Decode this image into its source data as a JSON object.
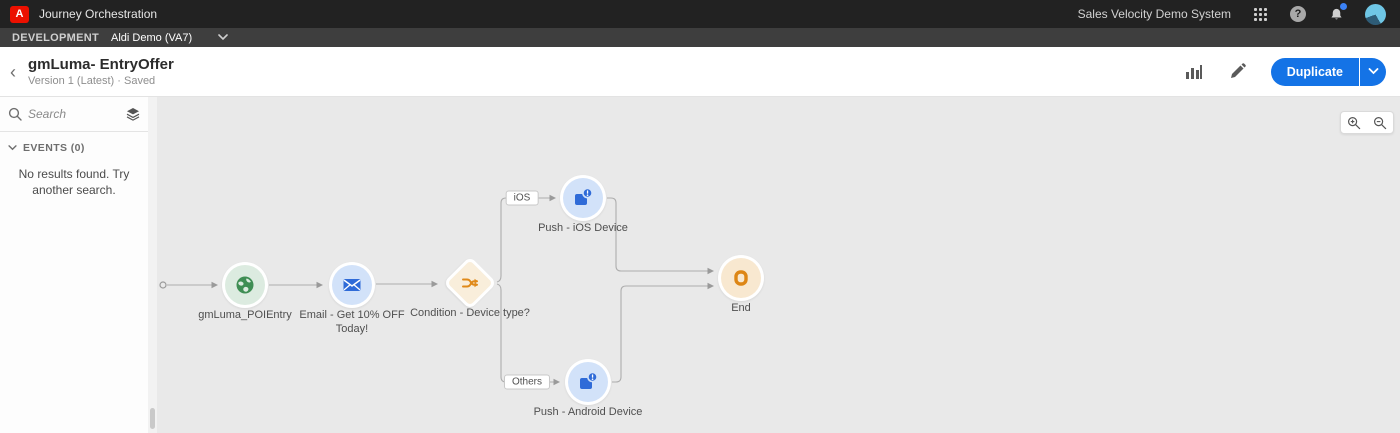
{
  "topbar": {
    "app_title": "Journey Orchestration",
    "org_name": "Sales Velocity Demo System"
  },
  "envbar": {
    "env_label": "DEVELOPMENT",
    "sandbox_name": "Aldi Demo (VA7)"
  },
  "header": {
    "back_glyph": "‹",
    "title": "gmLuma- EntryOffer",
    "subtitle": "Version 1 (Latest) · Saved",
    "duplicate_label": "Duplicate"
  },
  "sidebar": {
    "search_placeholder": "Search",
    "events_section_label": "EVENTS (0)",
    "empty_message": "No results found. Try another search."
  },
  "canvas": {
    "nodes": [
      {
        "type": "event",
        "label": "gmLuma_POIEntry"
      },
      {
        "type": "email",
        "label": "Email - Get 10% OFF Today!"
      },
      {
        "type": "condition",
        "label": "Condition - Device type?"
      },
      {
        "type": "push",
        "label": "Push - iOS Device"
      },
      {
        "type": "push",
        "label": "Push - Android Device"
      },
      {
        "type": "end",
        "label": "End"
      }
    ],
    "branch_labels": [
      "iOS",
      "Others"
    ]
  },
  "colors": {
    "adobe_red": "#eb1000",
    "primary_button_blue": "#1473e6",
    "event_green": "#3f8e54",
    "email_blue": "#2f6bd8",
    "condition_orange": "#e08a1a",
    "push_blue": "#2f6bd8",
    "end_orange": "#dd8615",
    "canvas_bg": "#e9e9e9",
    "topbar_bg": "#222222",
    "envbar_bg": "#3e3e3e"
  }
}
